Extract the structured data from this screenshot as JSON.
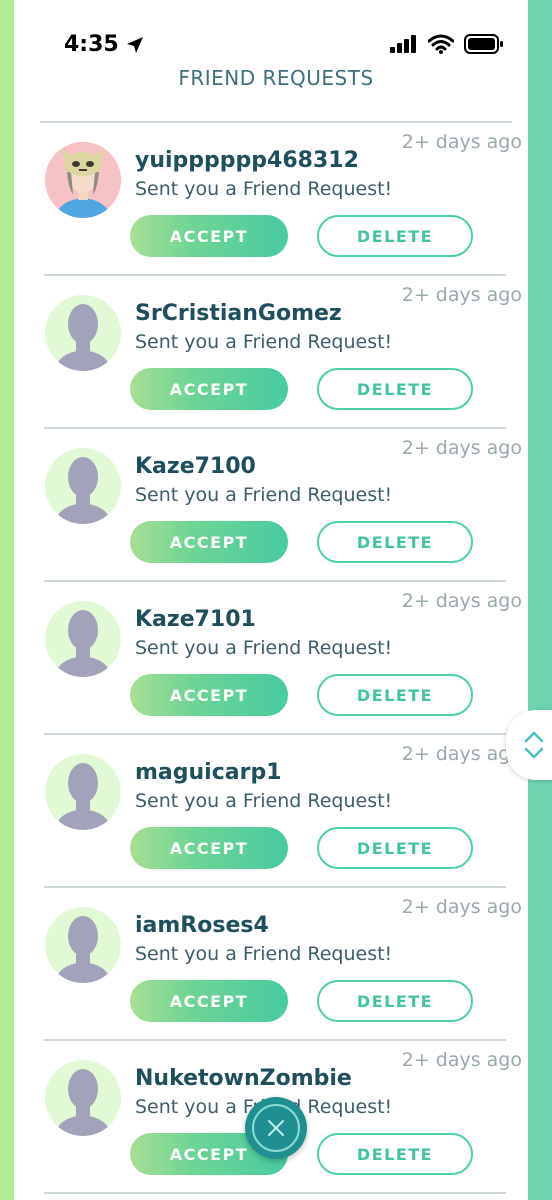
{
  "status_bar": {
    "time": "4:35",
    "icons": [
      "location-arrow-icon",
      "cellular-signal-icon",
      "wifi-icon",
      "battery-icon"
    ]
  },
  "header": {
    "title": "FRIEND REQUESTS"
  },
  "colors": {
    "accept_gradient_start": "#a7df93",
    "accept_gradient_end": "#48cba0",
    "delete_outline": "#4ecfac",
    "username": "#1f4e5c",
    "title": "#3f6e7c",
    "close_button": "#1f8f92"
  },
  "requests": [
    {
      "username": "yuipppppp468312",
      "message": "Sent you a Friend Request!",
      "time": "2+ days ago",
      "accept_label": "ACCEPT",
      "delete_label": "DELETE",
      "avatar": "custom-avatar"
    },
    {
      "username": "SrCristianGomez",
      "message": "Sent you a Friend Request!",
      "time": "2+ days ago",
      "accept_label": "ACCEPT",
      "delete_label": "DELETE",
      "avatar": "default-avatar"
    },
    {
      "username": "Kaze7100",
      "message": "Sent you a Friend Request!",
      "time": "2+ days ago",
      "accept_label": "ACCEPT",
      "delete_label": "DELETE",
      "avatar": "default-avatar"
    },
    {
      "username": "Kaze7101",
      "message": "Sent you a Friend Request!",
      "time": "2+ days ago",
      "accept_label": "ACCEPT",
      "delete_label": "DELETE",
      "avatar": "default-avatar"
    },
    {
      "username": "maguicarp1",
      "message": "Sent you a Friend Request!",
      "time": "2+ days ago",
      "accept_label": "ACCEPT",
      "delete_label": "DELETE",
      "avatar": "default-avatar"
    },
    {
      "username": "iamRoses4",
      "message": "Sent you a Friend Request!",
      "time": "2+ days ago",
      "accept_label": "ACCEPT",
      "delete_label": "DELETE",
      "avatar": "default-avatar"
    },
    {
      "username": "NuketownZombie",
      "message": "Sent you a Friend Request!",
      "time": "2+ days ago",
      "accept_label": "ACCEPT",
      "delete_label": "DELETE",
      "avatar": "default-avatar"
    }
  ],
  "controls": {
    "scroll_icons": [
      "chevron-up-icon",
      "chevron-down-icon"
    ],
    "close_icon": "close-icon"
  }
}
